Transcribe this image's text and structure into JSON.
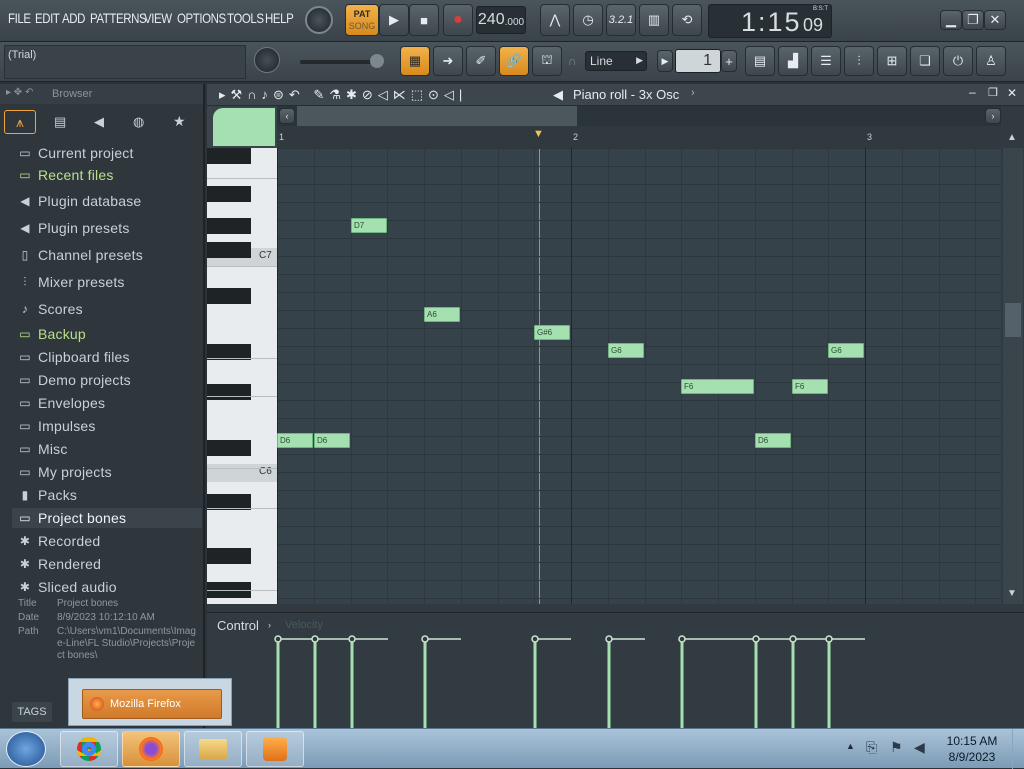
{
  "menu": {
    "items": [
      "FILE",
      "EDIT",
      "ADD",
      "PATTERNS",
      "VIEW",
      "OPTIONS",
      "TOOLS",
      "HELP"
    ]
  },
  "transport": {
    "pat_label": "PAT",
    "song_label": "SONG",
    "tempo": "240",
    "tempo_decimal": ".000",
    "time_main": "1:15",
    "time_sub": "09",
    "time_mode": "B:S:T",
    "snap": "Line",
    "pattern_number": "1"
  },
  "hint": {
    "text": "(Trial)"
  },
  "browser": {
    "title": "Browser",
    "items": [
      {
        "label": "Current project",
        "icon": "folder-icon",
        "style": "normal"
      },
      {
        "label": "Recent files",
        "icon": "folder-icon",
        "style": "green"
      },
      {
        "label": "Plugin database",
        "icon": "plug-icon",
        "style": "normal"
      },
      {
        "label": "Plugin presets",
        "icon": "plug-icon",
        "style": "normal"
      },
      {
        "label": "Channel presets",
        "icon": "channel-icon",
        "style": "normal"
      },
      {
        "label": "Mixer presets",
        "icon": "mixer-icon",
        "style": "normal"
      },
      {
        "label": "Scores",
        "icon": "note-icon",
        "style": "normal"
      },
      {
        "label": "Backup",
        "icon": "folder-icon",
        "style": "green"
      },
      {
        "label": "Clipboard files",
        "icon": "folder-icon",
        "style": "normal"
      },
      {
        "label": "Demo projects",
        "icon": "folder-icon",
        "style": "normal"
      },
      {
        "label": "Envelopes",
        "icon": "folder-icon",
        "style": "normal"
      },
      {
        "label": "Impulses",
        "icon": "folder-icon",
        "style": "normal"
      },
      {
        "label": "Misc",
        "icon": "folder-icon",
        "style": "normal"
      },
      {
        "label": "My projects",
        "icon": "folder-icon",
        "style": "normal"
      },
      {
        "label": "Packs",
        "icon": "packs-icon",
        "style": "normal"
      },
      {
        "label": "Project bones",
        "icon": "folder-icon",
        "style": "selected"
      },
      {
        "label": "Recorded",
        "icon": "recorded-icon",
        "style": "normal"
      },
      {
        "label": "Rendered",
        "icon": "rendered-icon",
        "style": "normal"
      },
      {
        "label": "Sliced audio",
        "icon": "sliced-icon",
        "style": "normal"
      }
    ],
    "info": {
      "title_label": "Title",
      "title_value": "Project bones",
      "date_label": "Date",
      "date_value": "8/9/2023 10:12:10 AM",
      "path_label": "Path",
      "path_value": "C:\\Users\\vm1\\Documents\\Image-Line\\FL Studio\\Projects\\Project bones\\"
    },
    "tags_label": "TAGS"
  },
  "piano_roll": {
    "title": "Piano roll - 3x Osc",
    "bar_numbers": [
      "1",
      "2",
      "3"
    ],
    "key_labels": [
      "C7",
      "C6"
    ],
    "control_label": "Control",
    "control_target": "Velocity",
    "notes": [
      {
        "label": "D6",
        "start": 0.0,
        "length": 0.5,
        "pitch": "D6"
      },
      {
        "label": "D6",
        "start": 0.5,
        "length": 0.5,
        "pitch": "D6"
      },
      {
        "label": "D7",
        "start": 1.0,
        "length": 0.5,
        "pitch": "D7"
      },
      {
        "label": "A6",
        "start": 2.0,
        "length": 0.5,
        "pitch": "A6"
      },
      {
        "label": "G#6",
        "start": 3.5,
        "length": 0.5,
        "pitch": "G#6"
      },
      {
        "label": "G6",
        "start": 4.5,
        "length": 0.5,
        "pitch": "G6"
      },
      {
        "label": "F6",
        "start": 5.5,
        "length": 1.0,
        "pitch": "F6"
      },
      {
        "label": "D6",
        "start": 6.5,
        "length": 0.5,
        "pitch": "D6"
      },
      {
        "label": "F6",
        "start": 7.0,
        "length": 0.5,
        "pitch": "F6"
      },
      {
        "label": "G6",
        "start": 7.5,
        "length": 0.5,
        "pitch": "G6"
      }
    ]
  },
  "taskbar": {
    "popup_label": "Mozilla Firefox",
    "time": "10:15 AM",
    "date": "8/9/2023"
  },
  "colors": {
    "note": "#a5e0b0",
    "accent": "#f2b24b",
    "green_text": "#b8e08c"
  }
}
